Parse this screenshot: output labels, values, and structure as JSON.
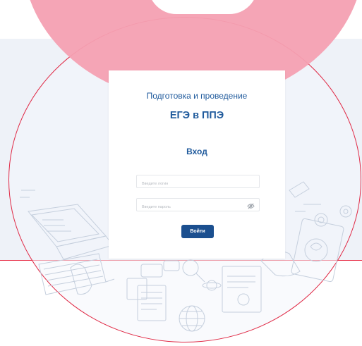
{
  "header": {
    "subtitle": "Подготовка и проведение",
    "title": "ЕГЭ в ППЭ"
  },
  "login": {
    "heading": "Вход",
    "login_placeholder": "Введите логин",
    "password_placeholder": "Введите пароль",
    "submit_label": "Войти"
  },
  "icons": {
    "password_toggle": "eye-off-icon"
  },
  "colors": {
    "brand": "#1f5a9c",
    "button": "#1b4f8f",
    "accent_red": "#e02945",
    "blob_pink": "#f4a0b2"
  }
}
